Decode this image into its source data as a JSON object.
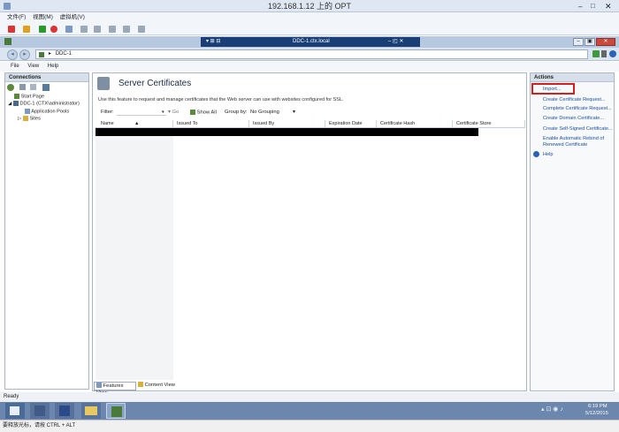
{
  "vm": {
    "title": "192.168.1.12 上的 OPT",
    "menus": [
      "文件(F)",
      "视图(M)",
      "虚拟机(V)"
    ]
  },
  "remote": {
    "title": "DDC-1.ctx.local"
  },
  "address": {
    "path": "DDC-1",
    "separator": "▸"
  },
  "menubar": [
    "File",
    "View",
    "Help"
  ],
  "connections": {
    "title": "Connections",
    "tree": [
      "Start Page",
      "DDC-1 (CTX\\administrator)",
      "Application Pools",
      "Sites"
    ]
  },
  "main": {
    "title": "Server Certificates",
    "description": "Use this feature to request and manage certificates that the Web server can use with websites configured for SSL.",
    "filter_label": "Filter:",
    "go_label": "Go",
    "show_all_label": "Show All",
    "group_by_label": "Group by:",
    "group_by_value": "No Grouping",
    "columns": [
      "Name",
      "Issued To",
      "Issued By",
      "Expiration Date",
      "Certificate Hash",
      "Certificate Store"
    ],
    "tabs": [
      "Features View",
      "Content View"
    ]
  },
  "actions": {
    "title": "Actions",
    "items": [
      "Import...",
      "Create Certificate Request...",
      "Complete Certificate Request...",
      "Create Domain Certificate...",
      "Create Self-Signed Certificate...",
      "Enable Automatic Rebind of",
      "Renewed Certificate",
      "Help"
    ]
  },
  "status": {
    "text": "Ready"
  },
  "clock": {
    "time": "6:19 PM",
    "date": "5/12/2015"
  },
  "bottom": {
    "text": "要释放光标，请按 CTRL + ALT"
  },
  "colors": {
    "accent": "#1a3f76",
    "highlight": "#d22020",
    "link": "#1a50a0"
  }
}
